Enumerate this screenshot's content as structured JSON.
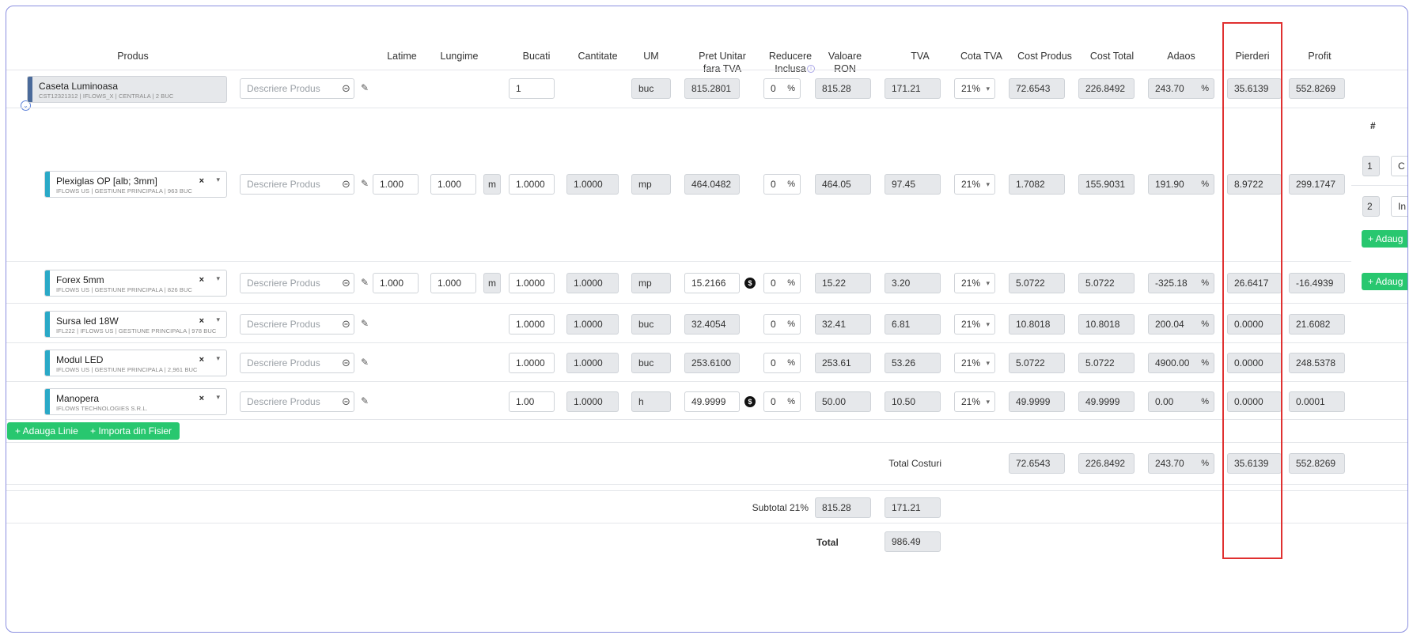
{
  "headers": {
    "produs": "Produs",
    "latime": "Latime",
    "lungime": "Lungime",
    "bucati": "Bucati",
    "cantitate": "Cantitate",
    "um": "UM",
    "pret_line1": "Pret Unitar",
    "pret_line2": "fara TVA",
    "reducere_line1": "Reducere",
    "reducere_line2": "Inclusa",
    "valoare_line1": "Valoare",
    "valoare_line2": "RON",
    "tva": "TVA",
    "cota_tva": "Cota TVA",
    "cost_produs": "Cost Produs",
    "cost_total": "Cost Total",
    "adaos": "Adaos",
    "pierderi": "Pierderi",
    "profit": "Profit",
    "hash": "#"
  },
  "parent": {
    "name": "Caseta Luminoasa",
    "sub": "CST12321312 | IFLOWS_X | CENTRALA | 2 BUC",
    "desc_placeholder": "Descriere Produs",
    "bucati": "1",
    "um": "buc",
    "pret": "815.2801",
    "reducere": "0",
    "valoare": "815.28",
    "tva": "171.21",
    "cota": "21%",
    "cost_produs": "72.6543",
    "cost_total": "226.8492",
    "adaos": "243.70",
    "pierderi": "35.6139",
    "profit": "552.8269"
  },
  "rows": [
    {
      "name": "Plexiglas OP [alb; 3mm]",
      "sub": "IFLOWS US | GESTIUNE PRINCIPALA | 963 BUC",
      "desc": "Descriere Produs",
      "latime": "1.000",
      "lungime": "1.000",
      "unit": "m",
      "bucati": "1.0000",
      "cantitate": "1.0000",
      "um": "mp",
      "pret": "464.0482",
      "reducere": "0",
      "valoare": "464.05",
      "tva": "97.45",
      "cota": "21%",
      "cost_produs": "1.7082",
      "cost_total": "155.9031",
      "adaos": "191.90",
      "pierderi": "8.9722",
      "profit": "299.1747"
    },
    {
      "name": "Forex 5mm",
      "sub": "IFLOWS US | GESTIUNE PRINCIPALA | 826 BUC",
      "desc": "Descriere Produs",
      "latime": "1.000",
      "lungime": "1.000",
      "unit": "m",
      "bucati": "1.0000",
      "cantitate": "1.0000",
      "um": "mp",
      "pret": "15.2166",
      "reducere": "0",
      "valoare": "15.22",
      "tva": "3.20",
      "cota": "21%",
      "cost_produs": "5.0722",
      "cost_total": "5.0722",
      "adaos": "-325.18",
      "pierderi": "26.6417",
      "profit": "-16.4939"
    },
    {
      "name": "Sursa led 18W",
      "sub": "IFL222 | IFLOWS US | GESTIUNE PRINCIPALA | 978 BUC",
      "desc": "Descriere Produs",
      "bucati": "1.0000",
      "cantitate": "1.0000",
      "um": "buc",
      "pret": "32.4054",
      "reducere": "0",
      "valoare": "32.41",
      "tva": "6.81",
      "cota": "21%",
      "cost_produs": "10.8018",
      "cost_total": "10.8018",
      "adaos": "200.04",
      "pierderi": "0.0000",
      "profit": "21.6082"
    },
    {
      "name": "Modul LED",
      "sub": "IFLOWS US | GESTIUNE PRINCIPALA | 2,961 BUC",
      "desc": "Descriere Produs",
      "bucati": "1.0000",
      "cantitate": "1.0000",
      "um": "buc",
      "pret": "253.6100",
      "reducere": "0",
      "valoare": "253.61",
      "tva": "53.26",
      "cota": "21%",
      "cost_produs": "5.0722",
      "cost_total": "5.0722",
      "adaos": "4900.00",
      "pierderi": "0.0000",
      "profit": "248.5378"
    },
    {
      "name": "Manopera",
      "sub": "IFLOWS TECHNOLOGIES S.R.L.",
      "desc": "Descriere Produs",
      "bucati": "1.00",
      "cantitate": "1.0000",
      "um": "h",
      "pret": "49.9999",
      "reducere": "0",
      "valoare": "50.00",
      "tva": "10.50",
      "cota": "21%",
      "cost_produs": "49.9999",
      "cost_total": "49.9999",
      "adaos": "0.00",
      "pierderi": "0.0000",
      "profit": "0.0001"
    }
  ],
  "side": {
    "row1_num": "1",
    "row1_text": "C",
    "row2_num": "2",
    "row2_text": "In",
    "add_btn1": "+ Adaug",
    "add_btn2": "+ Adaug"
  },
  "symbols": {
    "percent": "%",
    "dollar": "$",
    "times": "×"
  },
  "buttons": {
    "add_line": "+ Adauga Linie",
    "import": "+ Importa din Fisier"
  },
  "totals": {
    "label": "Total Costuri",
    "cost_produs": "72.6543",
    "cost_total": "226.8492",
    "adaos": "243.70",
    "pierderi": "35.6139",
    "profit": "552.8269",
    "subtotal_label": "Subtotal 21%",
    "subtotal_valoare": "815.28",
    "subtotal_tva": "171.21",
    "total_label": "Total",
    "total_value": "986.49"
  },
  "colors": {
    "green": "#28c76f",
    "accent_bar": "#2aa9c7",
    "parent_bar": "#4a6a9a",
    "highlight": "#e03030"
  }
}
